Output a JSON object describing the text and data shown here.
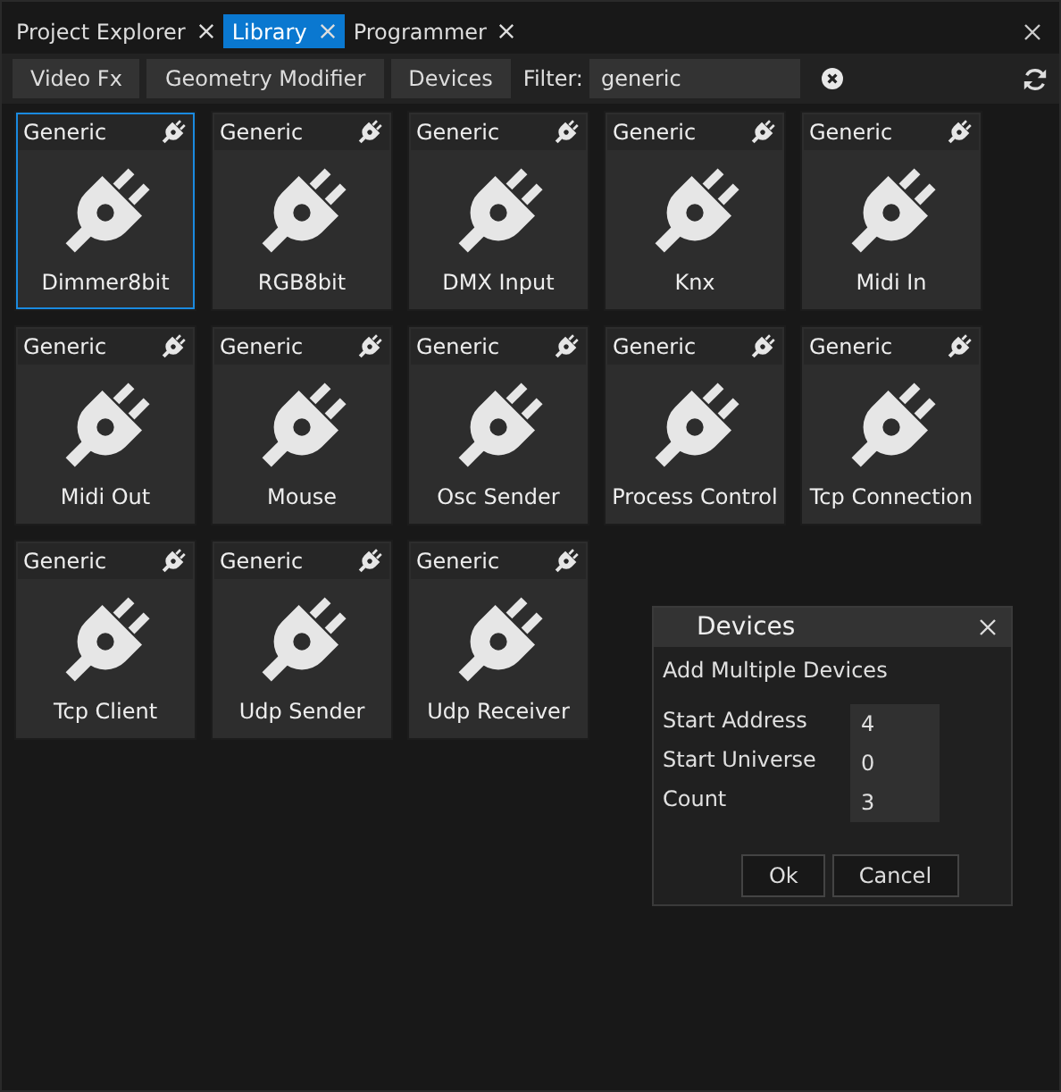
{
  "tabs": [
    {
      "label": "Project Explorer",
      "selected": false
    },
    {
      "label": "Library",
      "selected": true
    },
    {
      "label": "Programmer",
      "selected": false
    }
  ],
  "category_buttons": [
    "Video Fx",
    "Geometry Modifier",
    "Devices"
  ],
  "filter": {
    "label": "Filter:",
    "value": "generic"
  },
  "devices": [
    {
      "category": "Generic",
      "name": "Dimmer8bit",
      "selected": true
    },
    {
      "category": "Generic",
      "name": "RGB8bit",
      "selected": false
    },
    {
      "category": "Generic",
      "name": "DMX Input",
      "selected": false
    },
    {
      "category": "Generic",
      "name": "Knx",
      "selected": false
    },
    {
      "category": "Generic",
      "name": "Midi In",
      "selected": false
    },
    {
      "category": "Generic",
      "name": "Midi Out",
      "selected": false
    },
    {
      "category": "Generic",
      "name": "Mouse",
      "selected": false
    },
    {
      "category": "Generic",
      "name": "Osc Sender",
      "selected": false
    },
    {
      "category": "Generic",
      "name": "Process Control",
      "selected": false
    },
    {
      "category": "Generic",
      "name": "Tcp Connection",
      "selected": false
    },
    {
      "category": "Generic",
      "name": "Tcp Client",
      "selected": false
    },
    {
      "category": "Generic",
      "name": "Udp Sender",
      "selected": false
    },
    {
      "category": "Generic",
      "name": "Udp Receiver",
      "selected": false
    }
  ],
  "dialog": {
    "title": "Devices",
    "heading": "Add Multiple Devices",
    "fields": [
      {
        "label": "Start Address",
        "value": "4"
      },
      {
        "label": "Start Universe",
        "value": "0"
      },
      {
        "label": "Count",
        "value": "3"
      }
    ],
    "buttons": [
      "Ok",
      "Cancel"
    ]
  }
}
